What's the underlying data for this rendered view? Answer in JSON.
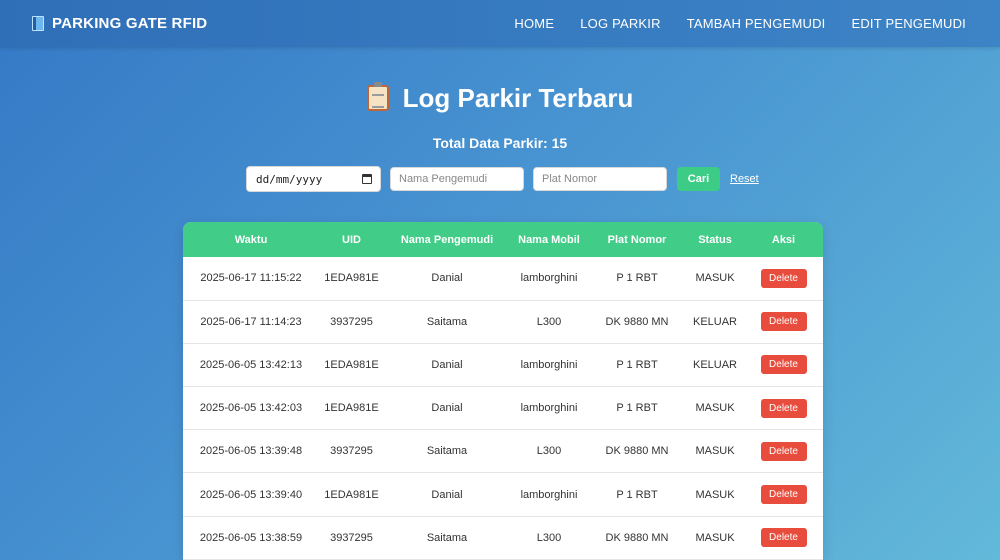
{
  "nav": {
    "brand": "PARKING GATE RFID",
    "links": [
      "HOME",
      "LOG PARKIR",
      "TAMBAH PENGEMUDI",
      "EDIT PENGEMUDI"
    ]
  },
  "page": {
    "title": "Log Parkir Terbaru",
    "total_label": "Total Data Parkir: 15"
  },
  "filters": {
    "date_placeholder": "dd/mm/yyyy",
    "name_placeholder": "Nama Pengemudi",
    "plate_placeholder": "Plat Nomor",
    "search_label": "Cari",
    "reset_label": "Reset"
  },
  "table": {
    "headers": [
      "Waktu",
      "UID",
      "Nama Pengemudi",
      "Nama Mobil",
      "Plat Nomor",
      "Status",
      "Aksi"
    ],
    "delete_label": "Delete",
    "rows": [
      [
        "2025-06-17 11:15:22",
        "1EDA981E",
        "Danial",
        "lamborghini",
        "P 1 RBT",
        "MASUK"
      ],
      [
        "2025-06-17 11:14:23",
        "3937295",
        "Saitama",
        "L300",
        "DK 9880 MN",
        "KELUAR"
      ],
      [
        "2025-06-05 13:42:13",
        "1EDA981E",
        "Danial",
        "lamborghini",
        "P 1 RBT",
        "KELUAR"
      ],
      [
        "2025-06-05 13:42:03",
        "1EDA981E",
        "Danial",
        "lamborghini",
        "P 1 RBT",
        "MASUK"
      ],
      [
        "2025-06-05 13:39:48",
        "3937295",
        "Saitama",
        "L300",
        "DK 9880 MN",
        "MASUK"
      ],
      [
        "2025-06-05 13:39:40",
        "1EDA981E",
        "Danial",
        "lamborghini",
        "P 1 RBT",
        "MASUK"
      ],
      [
        "2025-06-05 13:38:59",
        "3937295",
        "Saitama",
        "L300",
        "DK 9880 MN",
        "MASUK"
      ]
    ]
  },
  "colors": {
    "header_green": "#41cc87",
    "delete_red": "#e74c3c",
    "search_green": "#3dcc86"
  }
}
